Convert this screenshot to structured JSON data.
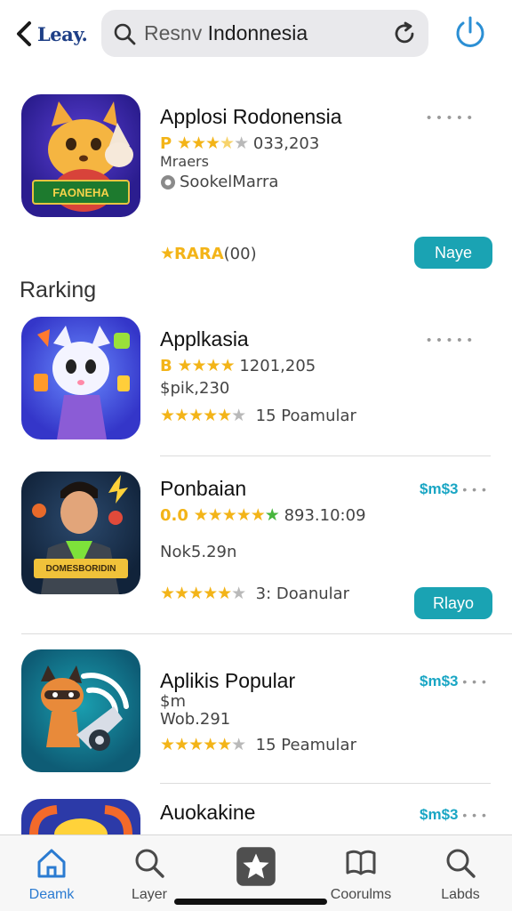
{
  "header": {
    "back_label": "Leay.",
    "search_prefix": "Resnv",
    "search_query": "Indonnesia"
  },
  "featured": {
    "name": "Applosi Rodonensia",
    "rating_lead": "P",
    "rating_count": "033,203",
    "line2": "Mraers",
    "publisher": "SookelMarra",
    "reviews_label": "(00)",
    "stars_text": "RARA",
    "menu": "• • • • •",
    "action": "Naye",
    "banner": "FAONEHA"
  },
  "section": {
    "title": "Rarking"
  },
  "apps": [
    {
      "name": "Applkasia",
      "rating_lead": "B",
      "rating_count": "1201,205",
      "line2": "$pik,230",
      "line3": "15 Poamular",
      "menu": "• • • • •"
    },
    {
      "name": "Ponbaian",
      "rating_lead": "0.0",
      "rating_count": "893.10:09",
      "line2": "Nok5.29n",
      "line3": "3: Doanular",
      "price": "$m$3",
      "action": "Rlayo",
      "banner": "DOMESBORIDIN"
    },
    {
      "name": "Aplikis Popular",
      "line2a": "$m",
      "line2": "Wob.291",
      "line3": "15 Peamular",
      "price": "$m$3"
    },
    {
      "name": "Auokakine",
      "price": "$m$3"
    }
  ],
  "nav": [
    {
      "label": "Deamk",
      "icon": "home-icon",
      "active": true
    },
    {
      "label": "Layer",
      "icon": "search-icon",
      "active": false
    },
    {
      "label": "",
      "icon": "star-icon",
      "active": false
    },
    {
      "label": "Coorulms",
      "icon": "book-icon",
      "active": false
    },
    {
      "label": "Labds",
      "icon": "search-icon",
      "active": false
    }
  ],
  "colors": {
    "accent": "#1aa3b3",
    "star": "#f3b418",
    "link": "#2b7bd1"
  }
}
